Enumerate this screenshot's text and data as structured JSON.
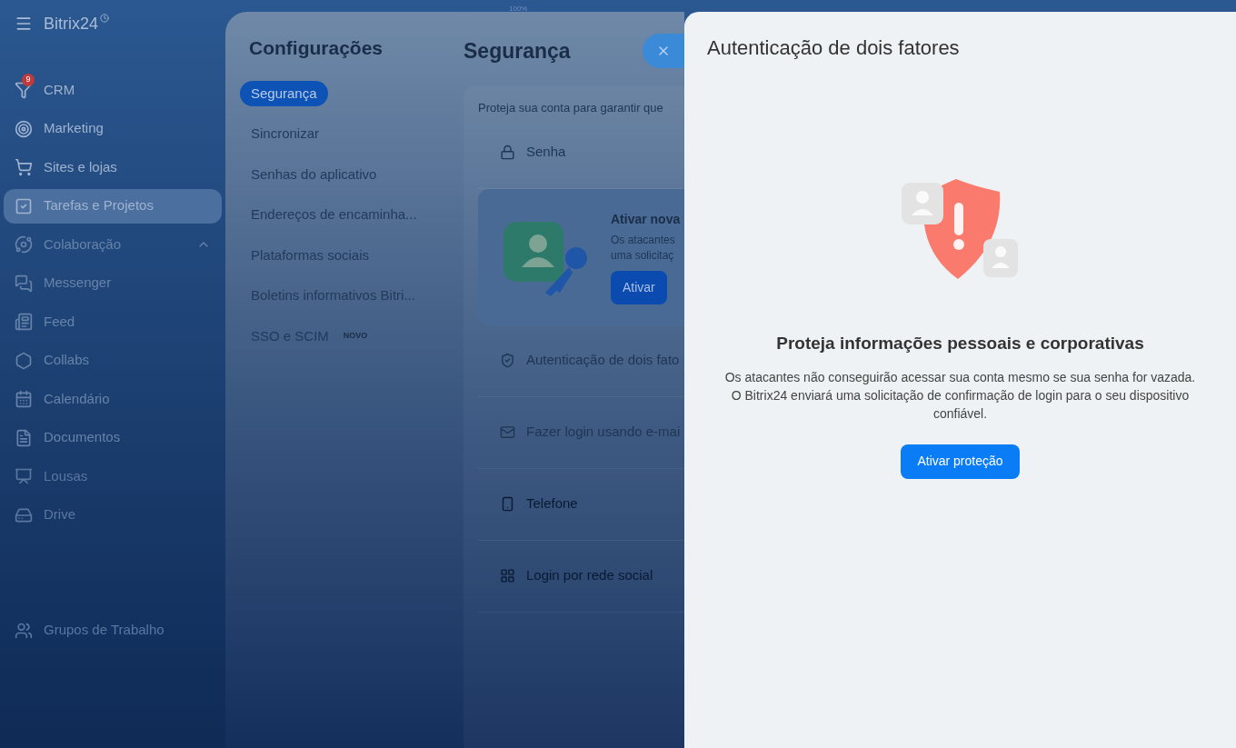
{
  "top_indicator": "100%",
  "sidebar": {
    "logo": "Bitrix24",
    "items": [
      {
        "label": "CRM",
        "kind": "crm",
        "badge": "9",
        "selected": false
      },
      {
        "label": "Marketing",
        "kind": "marketing",
        "selected": false
      },
      {
        "label": "Sites e lojas",
        "kind": "cart",
        "selected": false
      },
      {
        "label": "Tarefas e Projetos",
        "kind": "tasks",
        "selected": true
      },
      {
        "label": "Colaboração",
        "kind": "group",
        "expanded": true,
        "selected": false
      },
      {
        "label": "Messenger",
        "kind": "chat",
        "selected": false
      },
      {
        "label": "Feed",
        "kind": "feed",
        "selected": false
      },
      {
        "label": "Collabs",
        "kind": "hex",
        "selected": false
      },
      {
        "label": "Calendário",
        "kind": "calendar",
        "selected": false
      },
      {
        "label": "Documentos",
        "kind": "doc",
        "selected": false
      },
      {
        "label": "Lousas",
        "kind": "board",
        "selected": false
      },
      {
        "label": "Drive",
        "kind": "drive",
        "selected": false
      },
      {
        "label": "Grupos de Trabalho",
        "kind": "people",
        "selected": false
      }
    ]
  },
  "settings": {
    "title": "Configurações",
    "nav": [
      {
        "label": "Segurança",
        "selected": true
      },
      {
        "label": "Sincronizar",
        "selected": false
      },
      {
        "label": "Senhas do aplicativo",
        "selected": false
      },
      {
        "label": "Endereços de encaminha...",
        "selected": false
      },
      {
        "label": "Plataformas sociais",
        "selected": false
      },
      {
        "label": "Boletins informativos Bitri...",
        "selected": false
      },
      {
        "label": "SSO e SCIM",
        "badge": "NOVO",
        "selected": false
      }
    ]
  },
  "security": {
    "title": "Segurança",
    "intro": "Proteja sua conta para garantir que",
    "promo": {
      "title": "Ativar nova",
      "text": "Os atacantes uma solicitaç",
      "button": "Ativar"
    },
    "rows": [
      {
        "label": "Senha",
        "kind": "lock"
      },
      {
        "label": "Autenticação de dois fato",
        "kind": "shield"
      },
      {
        "label": "Fazer login usando e-mai",
        "kind": "mail"
      },
      {
        "label": "Telefone",
        "kind": "phone"
      },
      {
        "label": "Login por rede social",
        "kind": "grid"
      }
    ]
  },
  "panel": {
    "title": "Autenticação de dois fatores",
    "heading": "Proteja informações pessoais e corporativas",
    "text": "Os atacantes não conseguirão acessar sua conta mesmo se sua senha for vazada. O Bitrix24 enviará uma solicitação de confirmação de login para o seu dispositivo confiável.",
    "button": "Ativar proteção"
  }
}
